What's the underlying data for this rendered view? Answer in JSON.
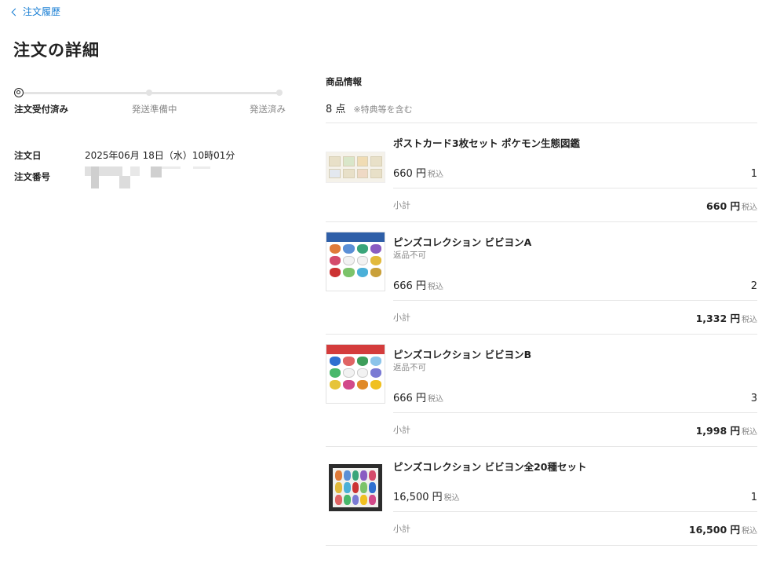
{
  "nav": {
    "back_label": "注文履歴"
  },
  "page": {
    "title": "注文の詳細"
  },
  "progress": {
    "steps": [
      {
        "label": "注文受付済み",
        "state": "current"
      },
      {
        "label": "発送準備中",
        "state": "pending"
      },
      {
        "label": "発送済み",
        "state": "pending"
      }
    ]
  },
  "order": {
    "date_label": "注文日",
    "date_value": "2025年06月 18日（水）10時01分",
    "number_label": "注文番号"
  },
  "products": {
    "section_title": "商品情報",
    "count": "8 点",
    "count_note": "※特典等を含む",
    "subtotal_label": "小計",
    "tax_label": "税込",
    "items": [
      {
        "name": "ポストカード3枚セット ポケモン生態図鑑",
        "note": "",
        "price": "660 円",
        "qty": "1",
        "subtotal": "660 円"
      },
      {
        "name": "ピンズコレクション ビビヨンA",
        "note": "返品不可",
        "price": "666 円",
        "qty": "2",
        "subtotal": "1,332 円"
      },
      {
        "name": "ピンズコレクション ビビヨンB",
        "note": "返品不可",
        "price": "666 円",
        "qty": "3",
        "subtotal": "1,998 円"
      },
      {
        "name": "ピンズコレクション ビビヨン全20種セット",
        "note": "",
        "price": "16,500 円",
        "qty": "1",
        "subtotal": "16,500 円"
      }
    ]
  },
  "colors": {
    "link": "#1a7fd4",
    "pins_a_band": "#2f5fa8",
    "pins_b_band": "#d43c3c"
  },
  "icons": {
    "back": "chevron-left-icon",
    "step_current": "current-step-icon"
  }
}
